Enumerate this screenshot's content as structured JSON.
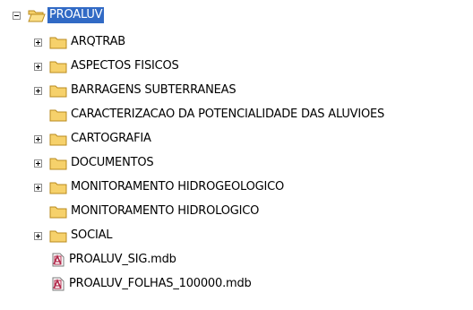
{
  "tree": {
    "root": {
      "label": "PROALUV",
      "icon": "open-folder-icon",
      "expanded": true,
      "selected": true
    },
    "items": [
      {
        "label": "ARQTRAB",
        "type": "folder",
        "expandable": true
      },
      {
        "label": "ASPECTOS FISICOS",
        "type": "folder",
        "expandable": true
      },
      {
        "label": "BARRAGENS SUBTERRANEAS",
        "type": "folder",
        "expandable": true
      },
      {
        "label": "CARACTERIZACAO DA POTENCIALIDADE DAS ALUVIOES",
        "type": "folder",
        "expandable": false
      },
      {
        "label": "CARTOGRAFIA",
        "type": "folder",
        "expandable": true
      },
      {
        "label": "DOCUMENTOS",
        "type": "folder",
        "expandable": true
      },
      {
        "label": "MONITORAMENTO HIDROGEOLOGICO",
        "type": "folder",
        "expandable": true
      },
      {
        "label": "MONITORAMENTO HIDROLOGICO",
        "type": "folder",
        "expandable": false
      },
      {
        "label": "SOCIAL",
        "type": "folder",
        "expandable": true
      },
      {
        "label": "PROALUV_SIG.mdb",
        "type": "file",
        "expandable": false
      },
      {
        "label": "PROALUV_FOLHAS_100000.mdb",
        "type": "file",
        "expandable": false
      }
    ]
  },
  "colors": {
    "selection": "#316ac5",
    "folder_fill": "#f6d16b",
    "folder_stroke": "#b98b1f"
  }
}
